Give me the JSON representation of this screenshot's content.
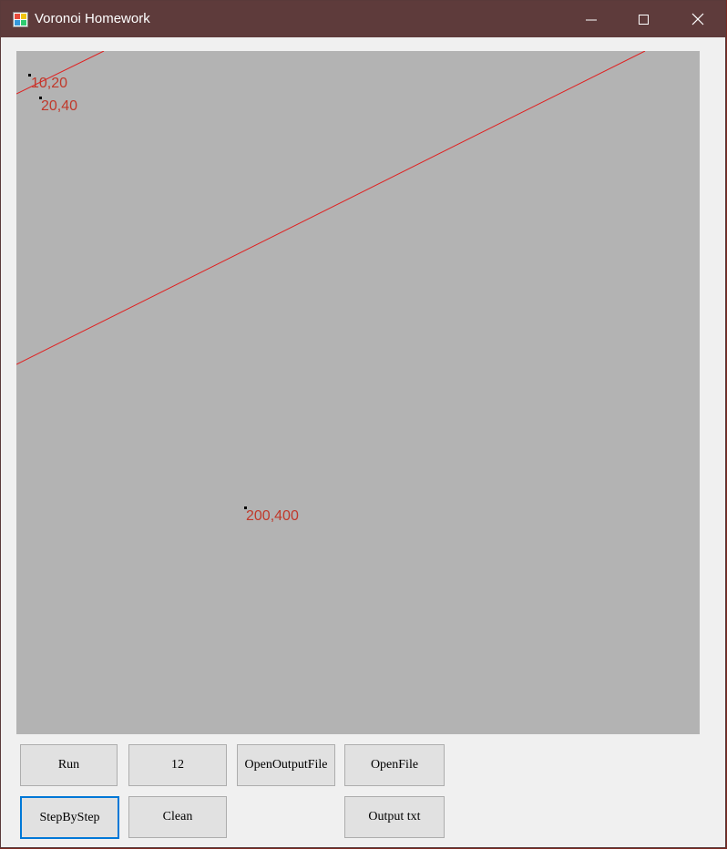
{
  "window": {
    "title": "Voronoi Homework"
  },
  "titlebar_buttons": {
    "minimize": "minimize-icon",
    "maximize": "maximize-icon",
    "close": "close-icon"
  },
  "canvas": {
    "background": "#b3b3b3",
    "line_color": "#e02020",
    "label_color": "#c0392b",
    "points": [
      {
        "label": "10,20"
      },
      {
        "label": "20,40"
      },
      {
        "label": "200,400"
      }
    ]
  },
  "buttons": {
    "run": "Run",
    "count": "12",
    "open_output_file": "OpenOutputFile",
    "open_file": "OpenFile",
    "step_by_step": "StepByStep",
    "clean": "Clean",
    "output_txt": "Output txt"
  }
}
